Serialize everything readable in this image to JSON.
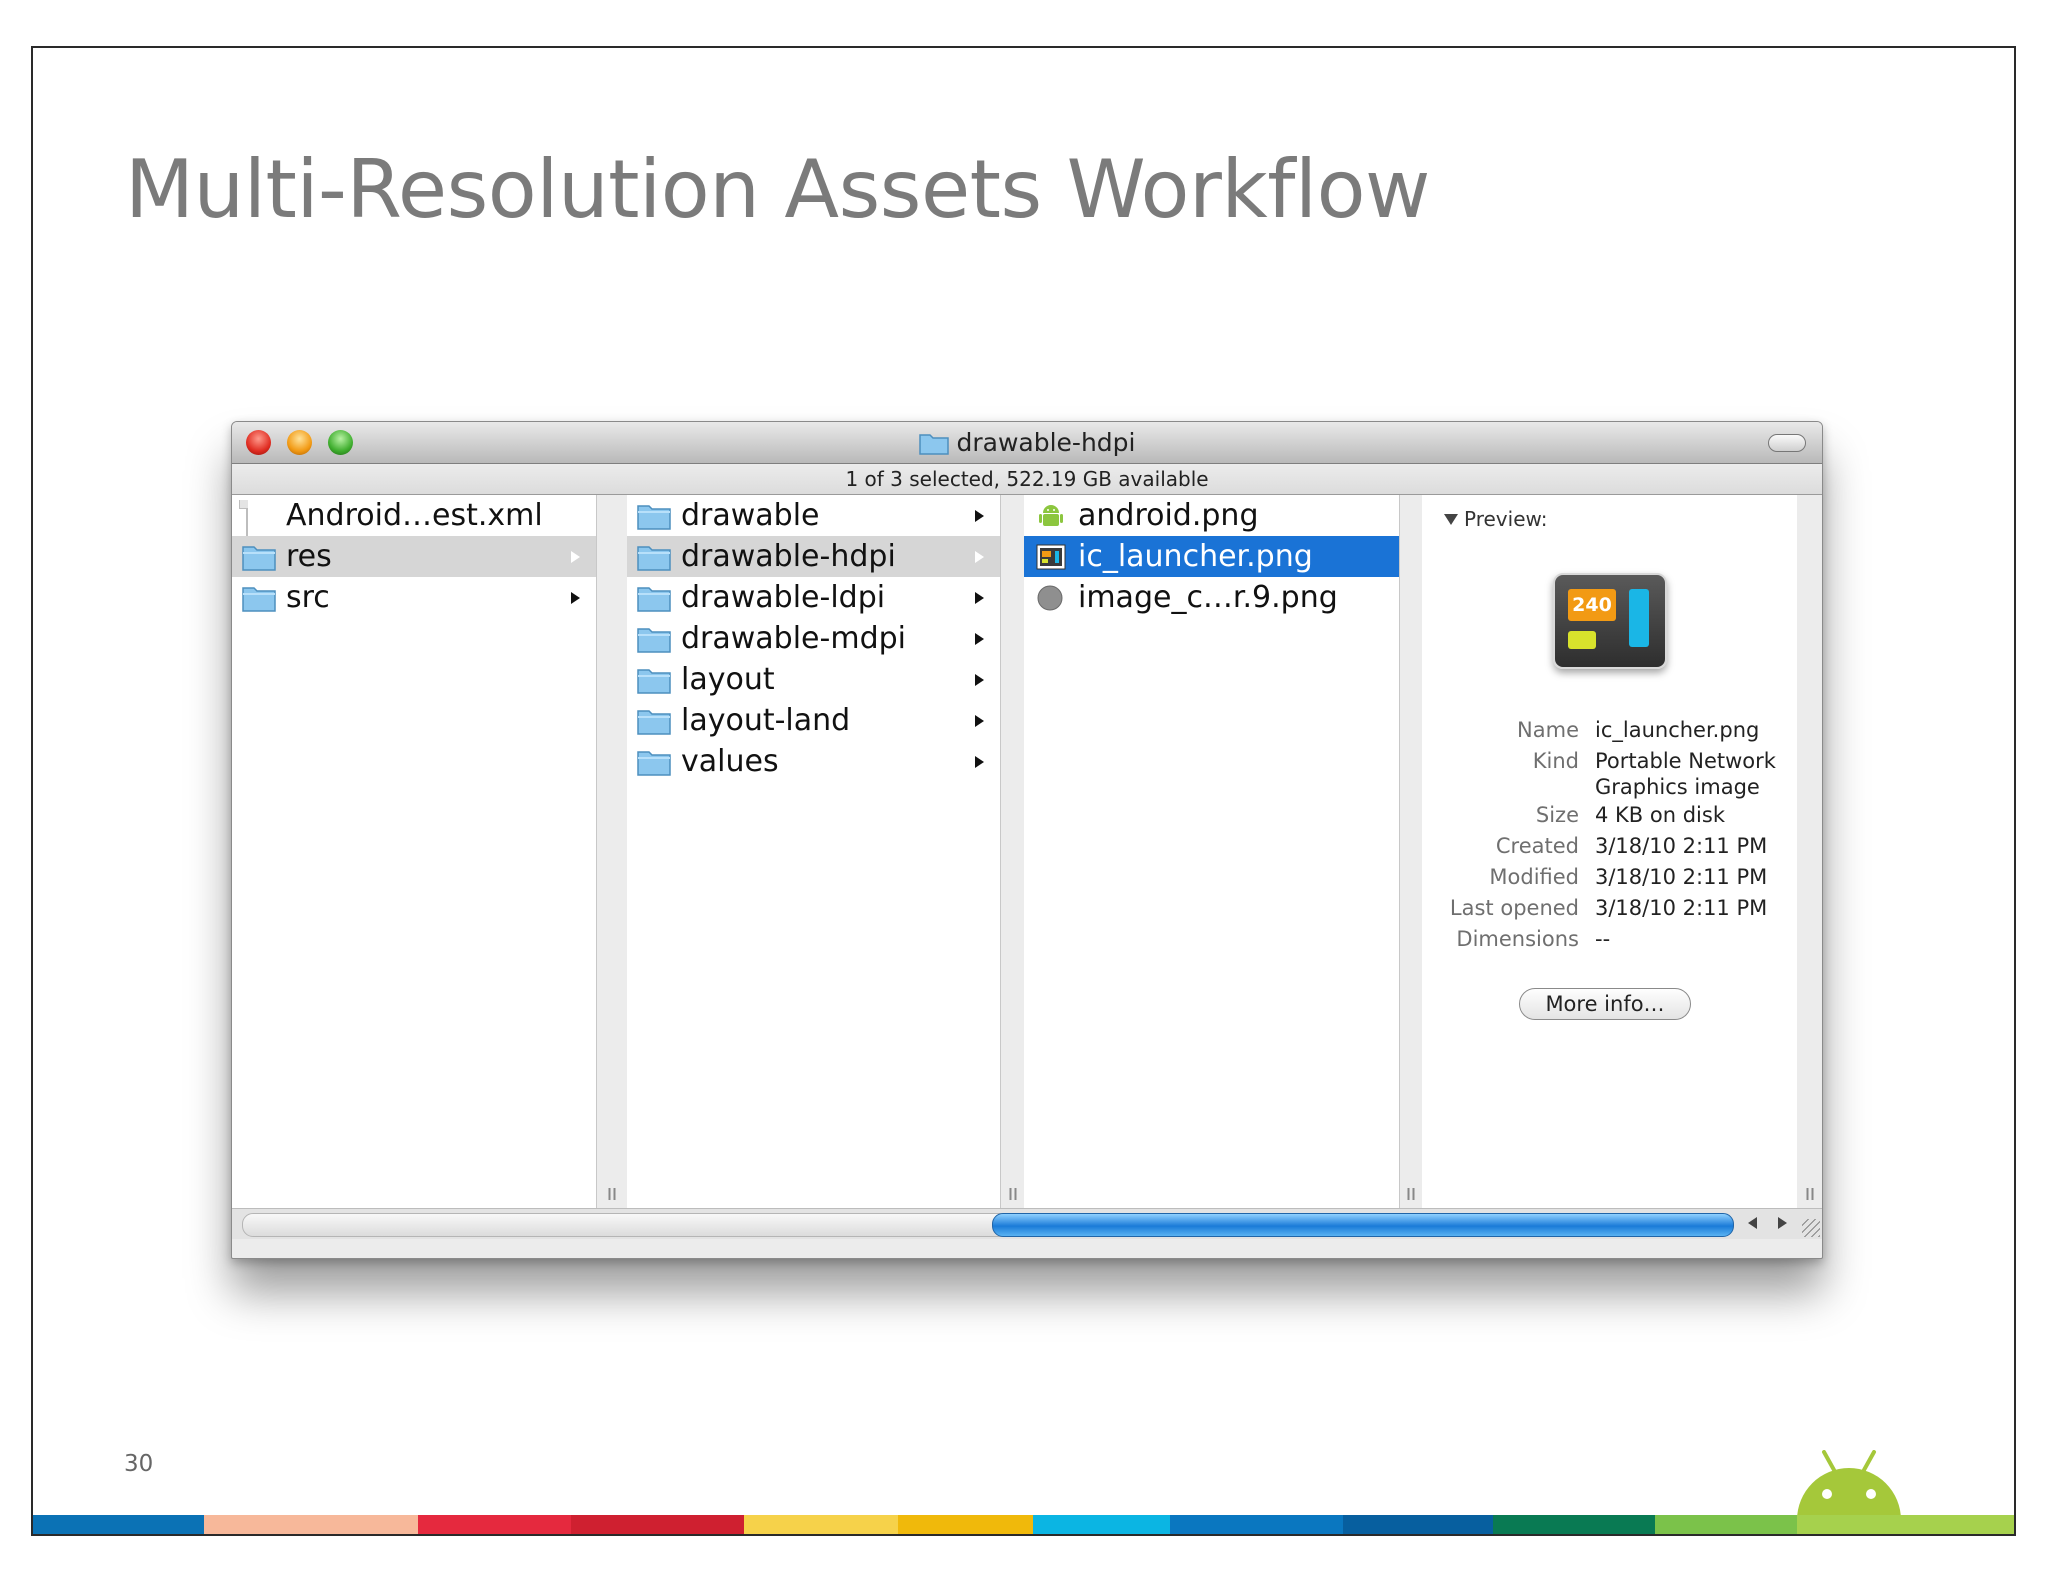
{
  "slide": {
    "title": "Multi-Resolution Assets Workflow",
    "page_number": "30",
    "color_bar": [
      "#0b72b5",
      "#f7b89a",
      "#e5293e",
      "#cf2030",
      "#f6d24a",
      "#f0b90b",
      "#0bb5e3",
      "#0a77c0",
      "#075f9f",
      "#097a53",
      "#7bc24a",
      "#a6d14d"
    ]
  },
  "window": {
    "title": "drawable-hdpi",
    "status": "1 of 3 selected, 522.19 GB available"
  },
  "columns": {
    "col1": [
      {
        "label": "Android…est.xml",
        "icon": "file-icon"
      },
      {
        "label": "res",
        "icon": "folder-icon"
      },
      {
        "label": "src",
        "icon": "folder-icon"
      }
    ],
    "col2": [
      {
        "label": "drawable",
        "icon": "folder-icon"
      },
      {
        "label": "drawable-hdpi",
        "icon": "folder-icon"
      },
      {
        "label": "drawable-ldpi",
        "icon": "folder-icon"
      },
      {
        "label": "drawable-mdpi",
        "icon": "folder-icon"
      },
      {
        "label": "layout",
        "icon": "folder-icon"
      },
      {
        "label": "layout-land",
        "icon": "folder-icon"
      },
      {
        "label": "values",
        "icon": "folder-icon"
      }
    ],
    "col3": [
      {
        "label": "android.png",
        "icon": "android-png-icon"
      },
      {
        "label": "ic_launcher.png",
        "icon": "image-icon"
      },
      {
        "label": "image_c…r.9.png",
        "icon": "gray-circle-icon"
      }
    ]
  },
  "preview": {
    "header": "Preview:",
    "thumb_text": "240",
    "info": [
      {
        "label": "Name",
        "value": "ic_launcher.png"
      },
      {
        "label": "Kind",
        "value": "Portable Network Graphics image"
      },
      {
        "label": "Size",
        "value": "4 KB on disk"
      },
      {
        "label": "Created",
        "value": "3/18/10 2:11 PM"
      },
      {
        "label": "Modified",
        "value": "3/18/10 2:11 PM"
      },
      {
        "label": "Last opened",
        "value": "3/18/10 2:11 PM"
      },
      {
        "label": "Dimensions",
        "value": "--"
      }
    ],
    "more_info": "More info…"
  }
}
